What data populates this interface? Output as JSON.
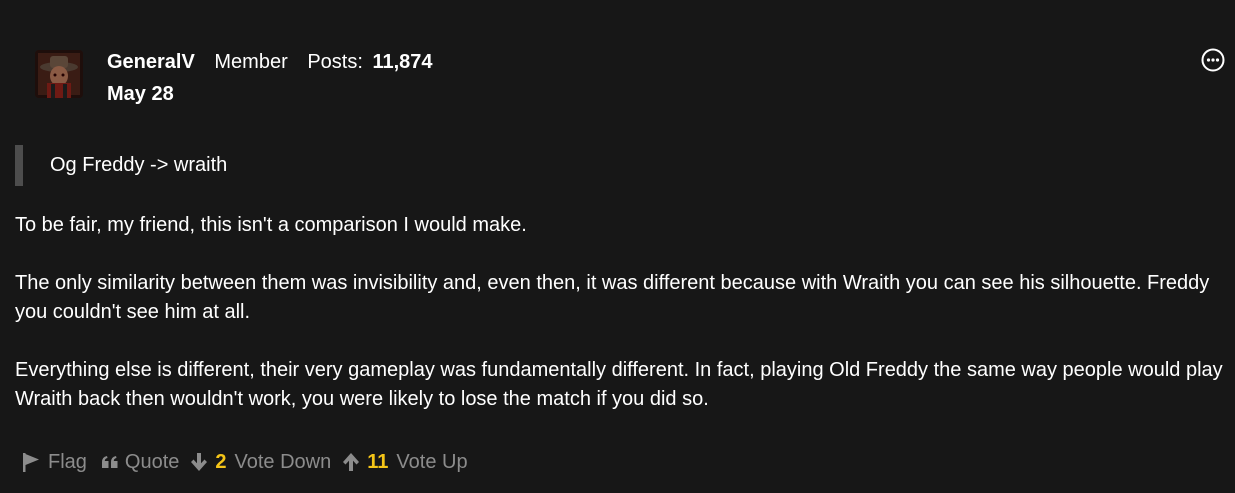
{
  "author": {
    "name": "GeneralV",
    "role": "Member",
    "posts_label": "Posts:",
    "posts_count": "11,874"
  },
  "post": {
    "date": "May 28",
    "quote": "Og Freddy -> wraith",
    "paragraphs": [
      "To be fair, my friend, this isn't a comparison I would make.",
      "The only similarity between them was invisibility and, even then, it was different because with Wraith you can see his silhouette. Freddy you couldn't see him at all.",
      "Everything else is different, their very gameplay was fundamentally different. In fact, playing Old Freddy the same way people would play Wraith back then wouldn't work, you were likely to lose the match if you did so."
    ]
  },
  "actions": {
    "flag_label": "Flag",
    "quote_label": "Quote",
    "vote_down_count": "2",
    "vote_down_label": "Vote Down",
    "vote_up_count": "11",
    "vote_up_label": "Vote Up"
  },
  "icons": {
    "options": "more-options-icon",
    "flag": "flag-icon",
    "quote": "quote-icon",
    "vote_down": "arrow-down-icon",
    "vote_up": "arrow-up-icon"
  },
  "colors": {
    "background": "#171717",
    "text": "#ffffff",
    "muted": "#8c8c8c",
    "vote_count": "#f5c518",
    "quote_bar": "#4d4d4d"
  }
}
